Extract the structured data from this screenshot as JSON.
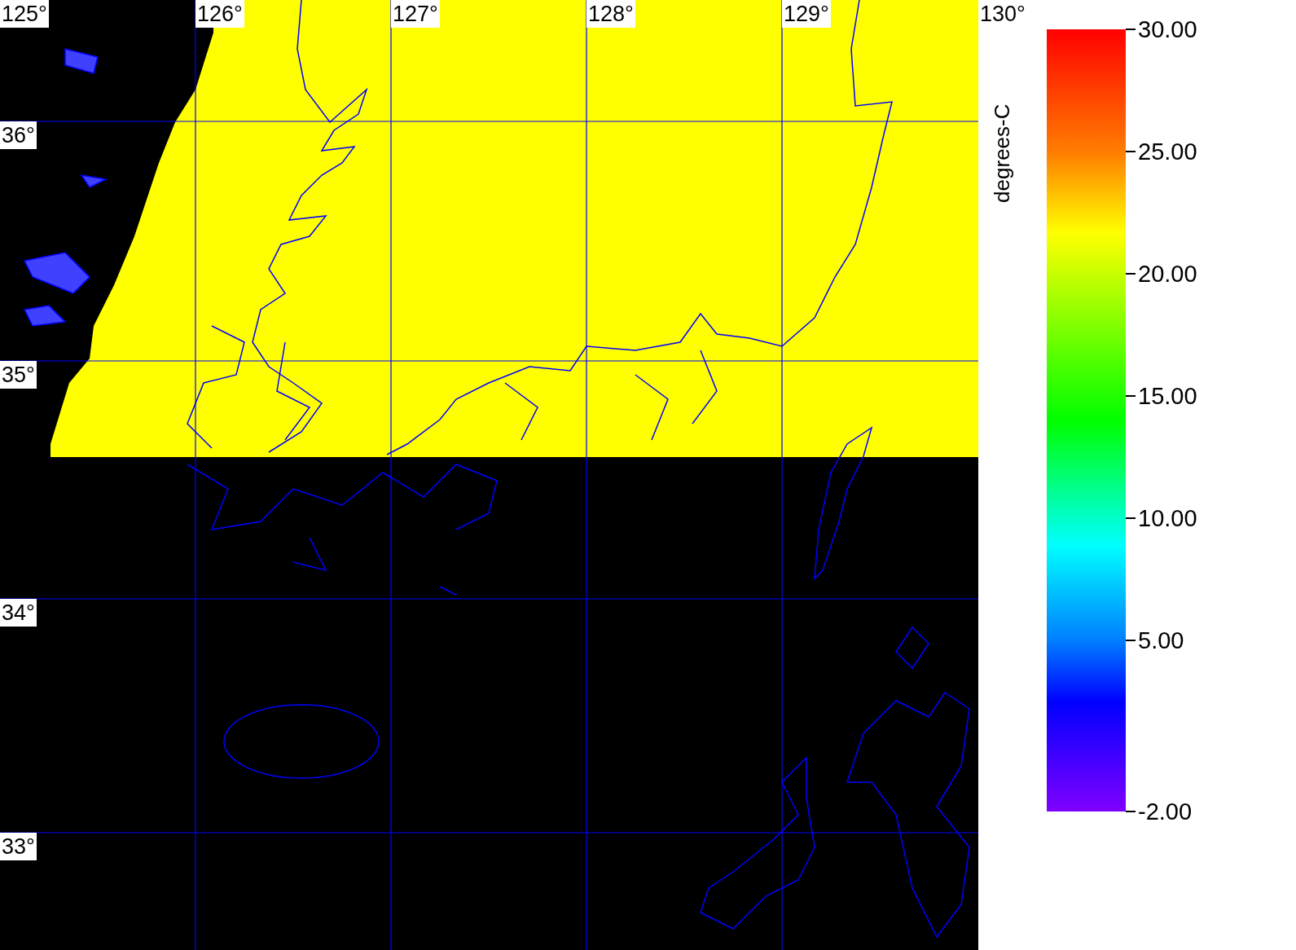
{
  "map": {
    "lon_labels": [
      "125°",
      "126°",
      "127°",
      "128°",
      "129°",
      "130°"
    ],
    "lat_labels": [
      "36°",
      "35°",
      "34°",
      "33°"
    ]
  },
  "colorbar": {
    "unit": "degrees-C",
    "ticks": [
      "30.00",
      "25.00",
      "20.00",
      "15.00",
      "10.00",
      "5.00",
      "-2.00"
    ]
  }
}
